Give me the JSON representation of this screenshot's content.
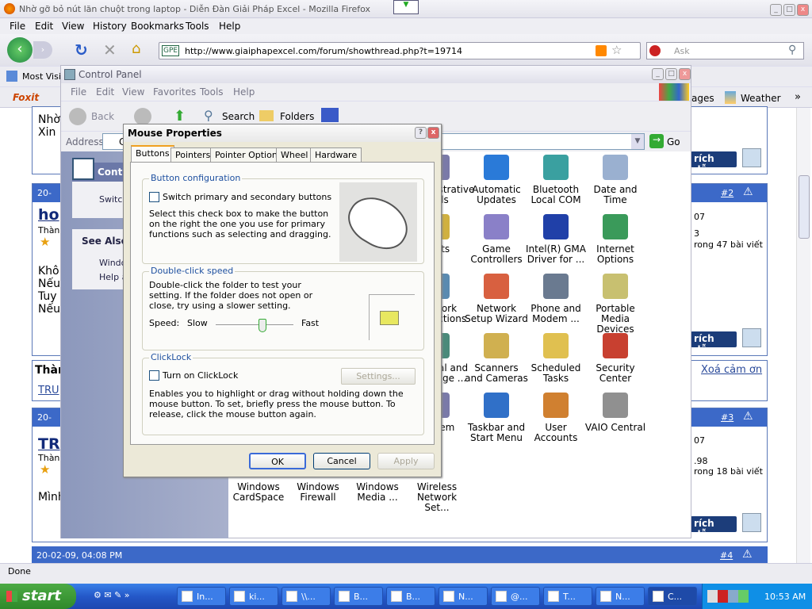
{
  "firefox": {
    "title": "Nhờ gỡ bỏ nút lăn chuột trong laptop - Diễn Đàn Giải Pháp Excel - Mozilla Firefox",
    "menu": [
      "File",
      "Edit",
      "View",
      "History",
      "Bookmarks",
      "Tools",
      "Help"
    ],
    "url": "http://www.giaiphapexcel.com/forum/showthread.php?t=19714",
    "site_badge": "GPE",
    "search_placeholder": "Ask",
    "bookmarks": {
      "most_visited": "Most Visit",
      "pages": "ages",
      "weather": "Weather",
      "more": "»"
    },
    "foxit": "Foxit",
    "status": "Done"
  },
  "forum": {
    "left_fragments": [
      "Nhờ",
      "Xin",
      "ho",
      "Thàn",
      "Khô",
      "Nếu",
      "Tuy",
      "Nếu",
      "Thàn",
      "TRU",
      "TR",
      "Thàn",
      "Mình"
    ],
    "post_date_fragment": "20-",
    "post4_date": "20-02-09, 04:08 PM",
    "quote_label": "rích dẫn",
    "posts": [
      {
        "num": "#2",
        "join": "07",
        "count": "3",
        "posts_text": "rong 47 bài viết"
      },
      {
        "num": "#3",
        "join": "07",
        "count": ".98",
        "posts_text": "rong 18 bài viết"
      },
      {
        "num": "#4"
      }
    ],
    "remove_thanks": "Xoá cảm ơn"
  },
  "control_panel": {
    "title": "Control Panel",
    "menu": [
      "File",
      "Edit",
      "View",
      "Favorites",
      "Tools",
      "Help"
    ],
    "toolbar": {
      "back": "Back",
      "search": "Search",
      "folders": "Folders"
    },
    "address_label": "Address",
    "address_value": "C",
    "go": "Go",
    "left": {
      "panel_title": "Contr",
      "switch": "Switch",
      "see_also": "See Also",
      "windows": "Windo",
      "help": "Help a"
    },
    "icons": [
      {
        "label": "Administrative Tools",
        "color": "#7a7aa8"
      },
      {
        "label": "Automatic Updates",
        "color": "#2a7ad8"
      },
      {
        "label": "Bluetooth Local COM",
        "color": "#3aa0a0"
      },
      {
        "label": "Date and Time",
        "color": "#9ab0d0"
      },
      {
        "label": "Fonts",
        "color": "#d0b040"
      },
      {
        "label": "Game Controllers",
        "color": "#8a80c8"
      },
      {
        "label": "Intel(R) GMA Driver for ...",
        "color": "#2040a8"
      },
      {
        "label": "Internet Options",
        "color": "#3a9a5a"
      },
      {
        "label": "Network Connections",
        "color": "#5a8ab0"
      },
      {
        "label": "Network Setup Wizard",
        "color": "#d86040"
      },
      {
        "label": "Phone and Modem ...",
        "color": "#6a7a90"
      },
      {
        "label": "Portable Media Devices",
        "color": "#c8c070"
      },
      {
        "label": "Regional and Language ...",
        "color": "#4a8a7a"
      },
      {
        "label": "Scanners and Cameras",
        "color": "#d0b050"
      },
      {
        "label": "Scheduled Tasks",
        "color": "#e0c050"
      },
      {
        "label": "Security Center",
        "color": "#c84030"
      },
      {
        "label": "System",
        "color": "#7a7aa8"
      },
      {
        "label": "Taskbar and Start Menu",
        "color": "#3070c8"
      },
      {
        "label": "User Accounts",
        "color": "#d08030"
      },
      {
        "label": "VAIO Central",
        "color": "#909090"
      },
      {
        "label": "Windows CardSpace",
        "color": "#ffffff"
      },
      {
        "label": "Windows Firewall",
        "color": "#ffffff"
      },
      {
        "label": "Windows Media ...",
        "color": "#ffffff"
      },
      {
        "label": "Wireless Network Set...",
        "color": "#ffffff"
      }
    ]
  },
  "dialog": {
    "title": "Mouse Properties",
    "tabs": [
      "Buttons",
      "Pointers",
      "Pointer Options",
      "Wheel",
      "Hardware"
    ],
    "active_tab": "Buttons",
    "button_config": {
      "legend": "Button configuration",
      "checkbox": "Switch primary and secondary buttons",
      "checked": false,
      "description": "Select this check box to make the button on the right the one you use for primary functions such as selecting and dragging."
    },
    "double_click": {
      "legend": "Double-click speed",
      "description": "Double-click the folder to test your setting. If the folder does not open or close, try using a slower setting.",
      "speed_label": "Speed:",
      "slow": "Slow",
      "fast": "Fast",
      "slider_value_percent": 60
    },
    "clicklock": {
      "legend": "ClickLock",
      "checkbox": "Turn on ClickLock",
      "checked": false,
      "settings": "Settings...",
      "description": "Enables you to highlight or drag without holding down the mouse button. To set, briefly press the mouse button. To release, click the mouse button again."
    },
    "ok": "OK",
    "cancel": "Cancel",
    "apply": "Apply"
  },
  "taskbar": {
    "start": "start",
    "items": [
      "In...",
      "ki...",
      "\\\\...",
      "B...",
      "B...",
      "N...",
      "@...",
      "T...",
      "N...",
      "C..."
    ],
    "clock": "10:53 AM"
  }
}
